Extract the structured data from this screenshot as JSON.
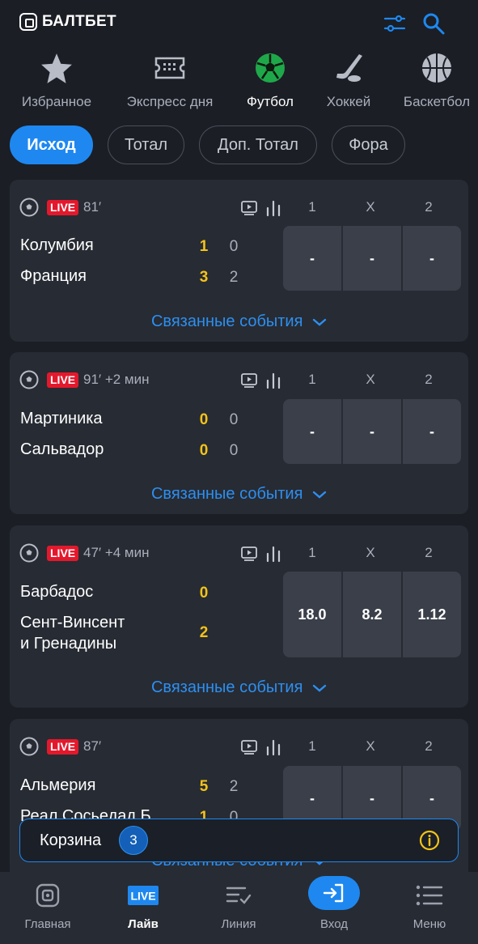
{
  "header": {
    "brand": "БАЛТБЕТ",
    "filter_icon": "filter-sliders-icon",
    "search_icon": "search-icon",
    "accent_color": "#1e88f0"
  },
  "sports": [
    {
      "label": "Избранное",
      "icon": "star-icon"
    },
    {
      "label": "Экспресс дня",
      "icon": "ticket-icon"
    },
    {
      "label": "Футбол",
      "icon": "soccer-ball-icon",
      "active": true
    },
    {
      "label": "Хоккей",
      "icon": "hockey-icon"
    },
    {
      "label": "Баскетбол",
      "icon": "basketball-icon"
    }
  ],
  "filters": [
    "Исход",
    "Тотал",
    "Доп. Тотал",
    "Фора"
  ],
  "active_filter": "Исход",
  "columns": [
    "1",
    "X",
    "2"
  ],
  "related_label": "Связанные события",
  "live_label": "LIVE",
  "matches": [
    {
      "time": "81′",
      "teams": [
        {
          "name": "Колумбия",
          "score": "1",
          "score2": "0"
        },
        {
          "name": "Франция",
          "score": "3",
          "score2": "2"
        }
      ],
      "odds": [
        "-",
        "-",
        "-"
      ]
    },
    {
      "time": "91′  +2 мин",
      "teams": [
        {
          "name": "Мартиника",
          "score": "0",
          "score2": "0"
        },
        {
          "name": "Сальвадор",
          "score": "0",
          "score2": "0"
        }
      ],
      "odds": [
        "-",
        "-",
        "-"
      ]
    },
    {
      "time": "47′  +4 мин",
      "teams": [
        {
          "name": "Барбадос",
          "score": "0",
          "score2": ""
        },
        {
          "name": "Сент-Винсент\nи Гренадины",
          "score": "2",
          "score2": ""
        }
      ],
      "odds": [
        "18.0",
        "8.2",
        "1.12"
      ]
    },
    {
      "time": "87′",
      "teams": [
        {
          "name": "Альмерия",
          "score": "5",
          "score2": "2"
        },
        {
          "name": "Реал Сосьедад Б",
          "score": "1",
          "score2": "0"
        }
      ],
      "odds": [
        "-",
        "-",
        "-"
      ]
    }
  ],
  "basket": {
    "label": "Корзина",
    "count": "3",
    "info_icon": "info-icon"
  },
  "bottom_nav": [
    {
      "label": "Главная",
      "icon": "home-icon"
    },
    {
      "label": "Лайв",
      "icon": "live-icon",
      "active": true
    },
    {
      "label": "Линия",
      "icon": "list-check-icon"
    },
    {
      "label": "Вход",
      "icon": "login-icon"
    },
    {
      "label": "Меню",
      "icon": "menu-icon"
    }
  ]
}
